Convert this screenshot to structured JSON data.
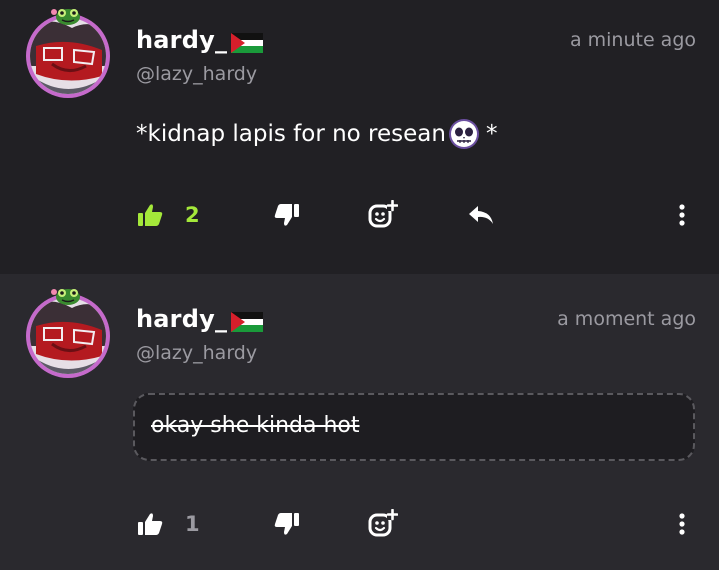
{
  "posts": [
    {
      "username": "hardy_",
      "handle": "@lazy_hardy",
      "timestamp": "a minute ago",
      "text": "*kidnap lapis for no resean",
      "text_suffix": "*",
      "struck": false,
      "likes": "2",
      "liked": true,
      "like_color": "#a4e83a"
    },
    {
      "username": "hardy_",
      "handle": "@lazy_hardy",
      "timestamp": "a moment ago",
      "text": "okay she kinda hot",
      "struck": true,
      "likes": "1",
      "liked": false,
      "like_color": "#9b9aa1"
    }
  ],
  "icons": {
    "avatar": "avatar-image",
    "frog_badge": "frog-icon",
    "flag": "palestine-flag-icon",
    "emoji": "skull-emoji-icon",
    "like": "thumbs-up-icon",
    "dislike": "thumbs-down-icon",
    "react": "add-reaction-icon",
    "reply": "reply-icon",
    "more": "more-vertical-icon"
  }
}
